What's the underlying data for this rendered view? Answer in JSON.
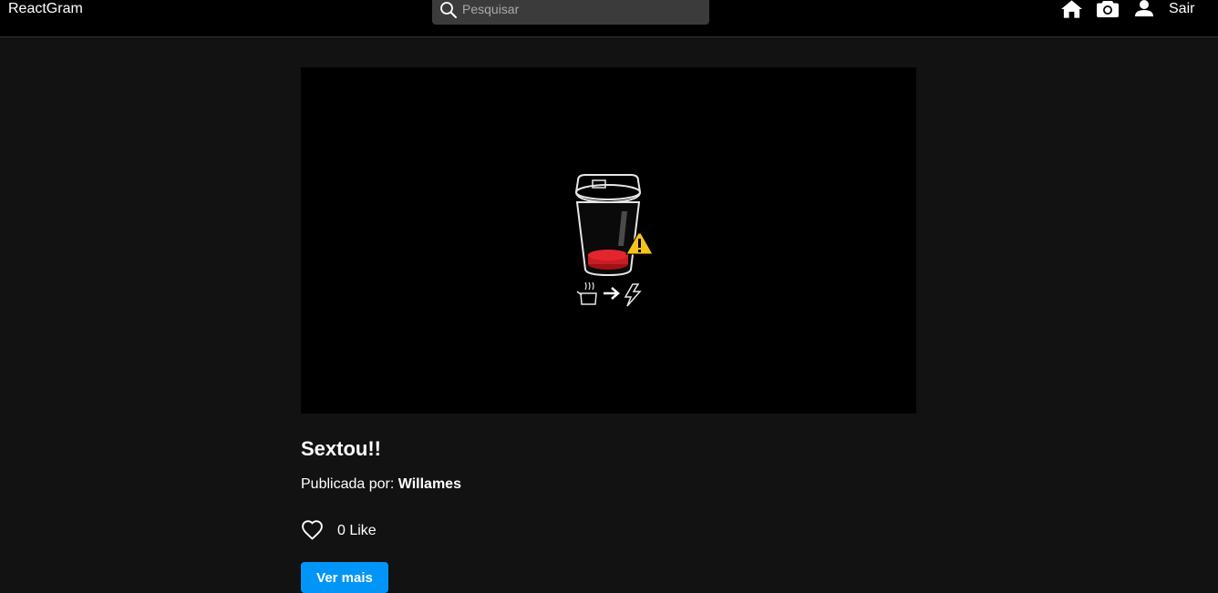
{
  "navbar": {
    "brand": "ReactGram",
    "search": {
      "placeholder": "Pesquisar",
      "value": ""
    },
    "icons": [
      "home-icon",
      "camera-icon",
      "user-icon"
    ],
    "logout_label": "Sair"
  },
  "photo": {
    "title": "Sextou!!",
    "author_prefix": "Publicada por:",
    "author_name": "Willames",
    "likes_text": "0 Like",
    "view_button_label": "Ver mais"
  },
  "colors": {
    "background": "#121212",
    "navbar": "#000000",
    "search_bg": "#3b3b3b",
    "button": "#0095f6",
    "battery_red": "#e3262e",
    "warning_yellow": "#f7c21a"
  }
}
